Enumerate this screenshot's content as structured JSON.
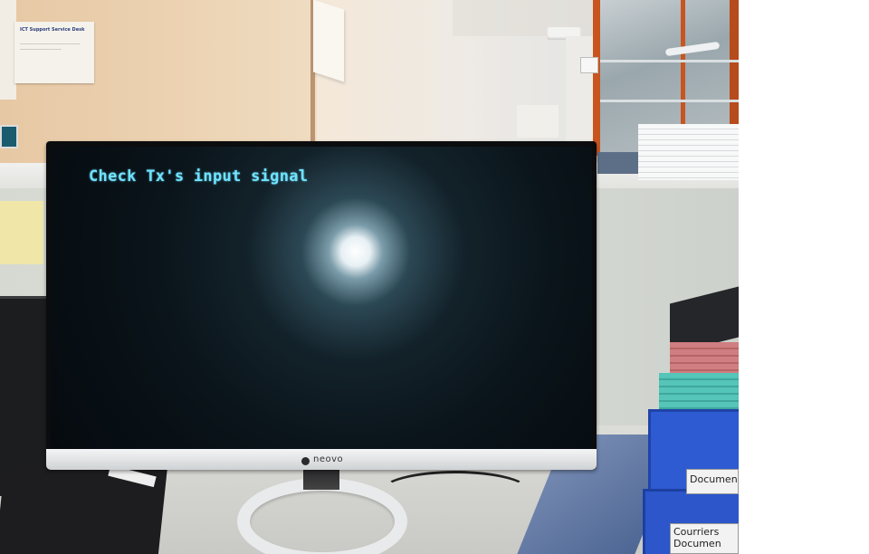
{
  "photo": {
    "description_colors": {
      "screen_text": "#6fe3ff",
      "accent_orange_frame": "#c8551f",
      "tray_blue": "#2e5bd1"
    },
    "monitor": {
      "screen_message": "Check Tx's input signal",
      "brand_logo": "neovo"
    },
    "wall_notice": {
      "title": "ICT Support Service Desk"
    },
    "trays": {
      "label_1": "Documen",
      "label_2_line1": "Courriers",
      "label_2_line2": "Documen"
    },
    "icons": [
      "neovo-logo-icon"
    ]
  }
}
